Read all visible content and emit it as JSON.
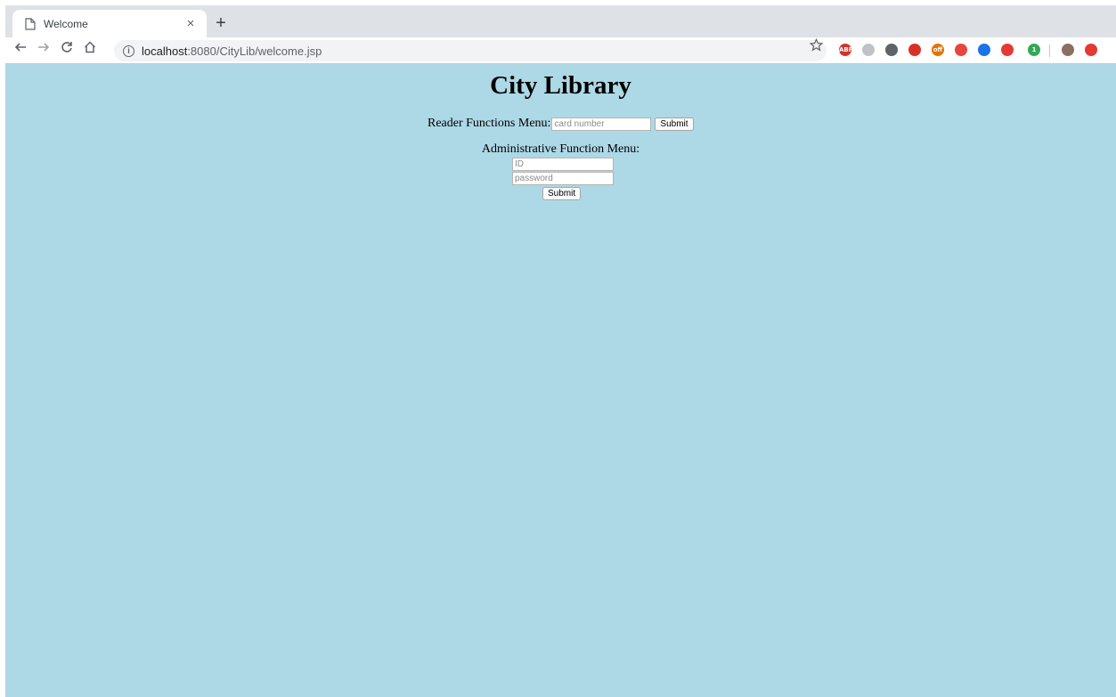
{
  "browser": {
    "tab_title": "Welcome",
    "tab_close": "×",
    "new_tab": "+",
    "url_host": "localhost",
    "url_path": ":8080/CityLib/welcome.jsp",
    "info_glyph": "i",
    "extensions": [
      {
        "name": "adblock-plus",
        "label": "ABP",
        "color": "#d0342c"
      },
      {
        "name": "ext-gray",
        "label": "",
        "color": "#bfc3c7"
      },
      {
        "name": "ext-grid",
        "label": "",
        "color": "#5f6368"
      },
      {
        "name": "ext-stop",
        "label": "",
        "color": "#d93025"
      },
      {
        "name": "ext-off",
        "label": "off",
        "color": "#e37400"
      },
      {
        "name": "ext-robot",
        "label": "",
        "color": "#e8453c"
      },
      {
        "name": "ext-windows",
        "label": "",
        "color": "#1a73e8"
      },
      {
        "name": "ext-apple",
        "label": "",
        "color": "#e53935"
      },
      {
        "name": "ext-green",
        "label": "1",
        "color": "#34a853"
      },
      {
        "name": "profile",
        "label": "",
        "color": "#8d6e63"
      },
      {
        "name": "ext-red",
        "label": "",
        "color": "#e53935"
      }
    ]
  },
  "page": {
    "title": "City Library",
    "reader_label": "Reader Functions Menu:",
    "card_placeholder": "card number",
    "reader_submit": "Submit",
    "admin_label": "Administrative Function Menu:",
    "id_placeholder": "ID",
    "password_placeholder": "password",
    "admin_submit": "Submit"
  },
  "colors": {
    "page_background": "#add8e6"
  }
}
